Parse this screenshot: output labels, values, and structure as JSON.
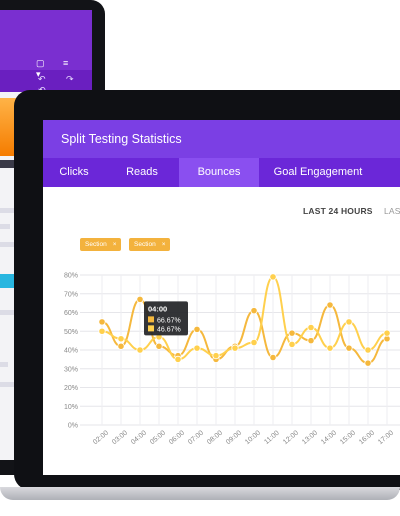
{
  "dashboard": {
    "title": "Split Testing Statistics",
    "tabs": [
      {
        "label": "Clicks",
        "active": false
      },
      {
        "label": "Reads",
        "active": false
      },
      {
        "label": "Bounces",
        "active": true
      },
      {
        "label": "Goal Engagement",
        "active": false
      }
    ],
    "range_options": [
      "LAST 24 HOURS",
      "LAST"
    ],
    "filters": [
      {
        "label": "Section",
        "remove_icon": "×"
      },
      {
        "label": "Section",
        "remove_icon": "×"
      }
    ]
  },
  "tooltip": {
    "time": "04:00",
    "rows": [
      "66.67%",
      "46.67%"
    ]
  },
  "colors": {
    "header": "#7b3fe4",
    "tabs": "#6b27d8",
    "tab_active": "#8a4ff0",
    "series_a": "#f5b83d",
    "series_b": "#ffd04d",
    "chip": "#f3b23d"
  },
  "chart_data": {
    "type": "line",
    "x": [
      "02:00",
      "03:00",
      "04:00",
      "05:00",
      "06:00",
      "07:00",
      "08:00",
      "09:00",
      "10:00",
      "11:00",
      "12:00",
      "13:00",
      "14:00",
      "15:00",
      "16:00",
      "17:00"
    ],
    "y_ticks": [
      "0%",
      "10%",
      "20%",
      "30%",
      "40%",
      "50%",
      "60%",
      "70%",
      "80%"
    ],
    "ylim": [
      0,
      80
    ],
    "grid": true,
    "series": [
      {
        "values": [
          55,
          42,
          67,
          42,
          37,
          51,
          35,
          42,
          61,
          36,
          49,
          45,
          64,
          41,
          33,
          46
        ]
      },
      {
        "values": [
          50,
          46,
          40,
          47,
          35,
          41,
          37,
          41,
          44,
          79,
          43,
          52,
          41,
          55,
          40,
          49
        ]
      }
    ]
  }
}
